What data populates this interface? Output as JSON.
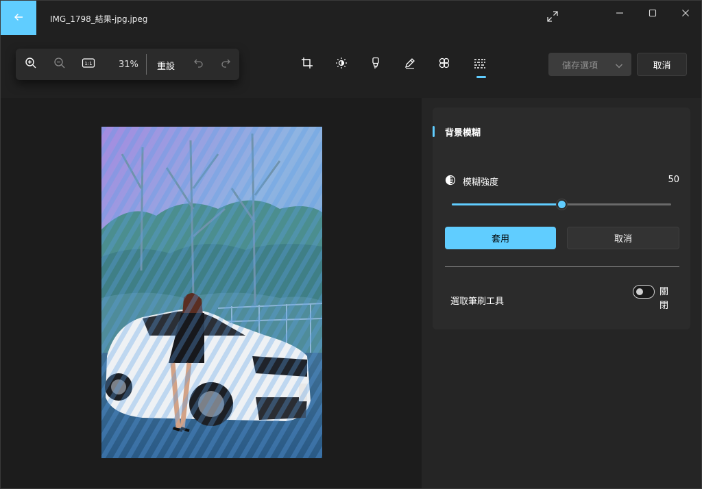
{
  "window": {
    "file_title": "IMG_1798_結果-jpg.jpeg"
  },
  "icons": {
    "back": "arrow-left-icon",
    "fullscreen": "expand-icon",
    "minimize": "minimize-icon",
    "maximize": "maximize-icon",
    "close": "close-icon",
    "zoom_in": "zoom-in-icon",
    "zoom_out": "zoom-out-icon",
    "actual_size": "actual-size-icon",
    "undo": "undo-icon",
    "redo": "redo-icon",
    "crop": "crop-icon",
    "adjust": "brightness-icon",
    "markup": "marker-icon",
    "draw": "pen-icon",
    "filters": "filters-icon",
    "background": "background-blur-icon",
    "chevron": "chevron-down-icon",
    "intensity": "contrast-icon"
  },
  "toolbar": {
    "actual_size_label": "1:1",
    "zoom_value": "31%",
    "reset_label": "重設",
    "save_label": "儲存選項",
    "cancel_label": "取消",
    "active_tool": "background"
  },
  "panel": {
    "title": "背景模糊",
    "intensity_label": "模糊強度",
    "intensity_value": "50",
    "intensity_fraction": 0.5,
    "apply_label": "套用",
    "cancel_label": "取消",
    "brush_label": "選取筆刷工具",
    "brush_state": "關閉",
    "brush_enabled": false
  },
  "colors": {
    "accent": "#60cdff",
    "window_bg": "#202020",
    "panel_bg": "#2b2b2b"
  }
}
